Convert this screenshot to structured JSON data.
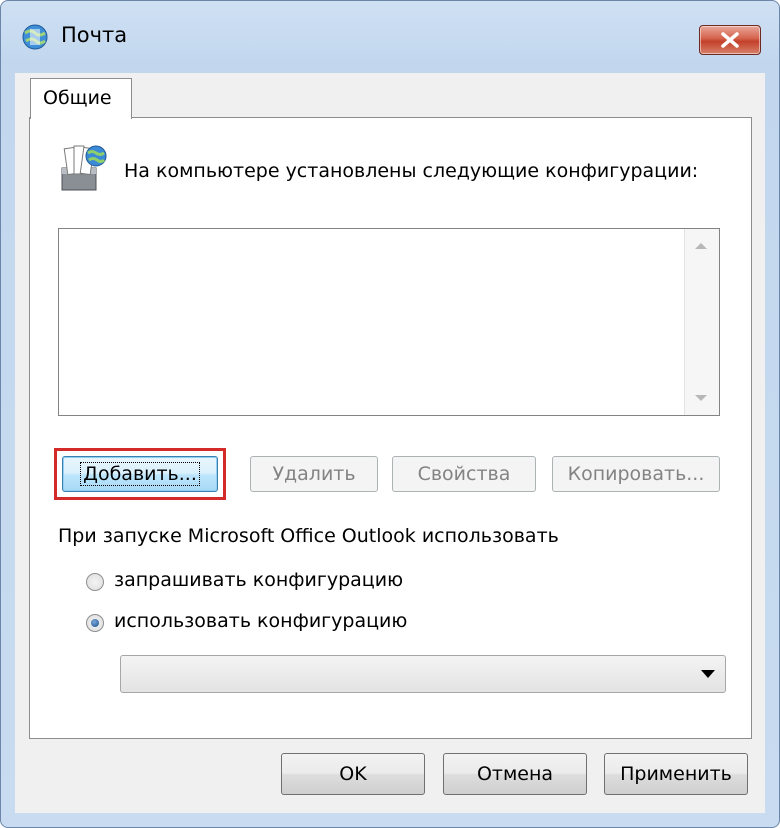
{
  "window": {
    "title": "Почта",
    "accent": "#d42a2a"
  },
  "tabs": [
    {
      "label": "Общие",
      "selected": true
    }
  ],
  "general": {
    "intro_text": "На компьютере установлены следующие конфигурации:",
    "configurations": [],
    "buttons": {
      "add": "Добавить...",
      "remove": "Удалить",
      "properties": "Свойства",
      "copy": "Копировать..."
    },
    "startup_label": "При запуске Microsoft Office Outlook использовать",
    "options": [
      {
        "label": "запрашивать конфигурацию",
        "checked": false
      },
      {
        "label": "использовать конфигурацию",
        "checked": true
      }
    ],
    "selected_configuration": ""
  },
  "footer": {
    "ok": "OK",
    "cancel": "Отмена",
    "apply": "Применить"
  },
  "icons": {
    "app": "mail-globe-icon",
    "config": "mail-folder-icon",
    "close": "close-icon"
  }
}
